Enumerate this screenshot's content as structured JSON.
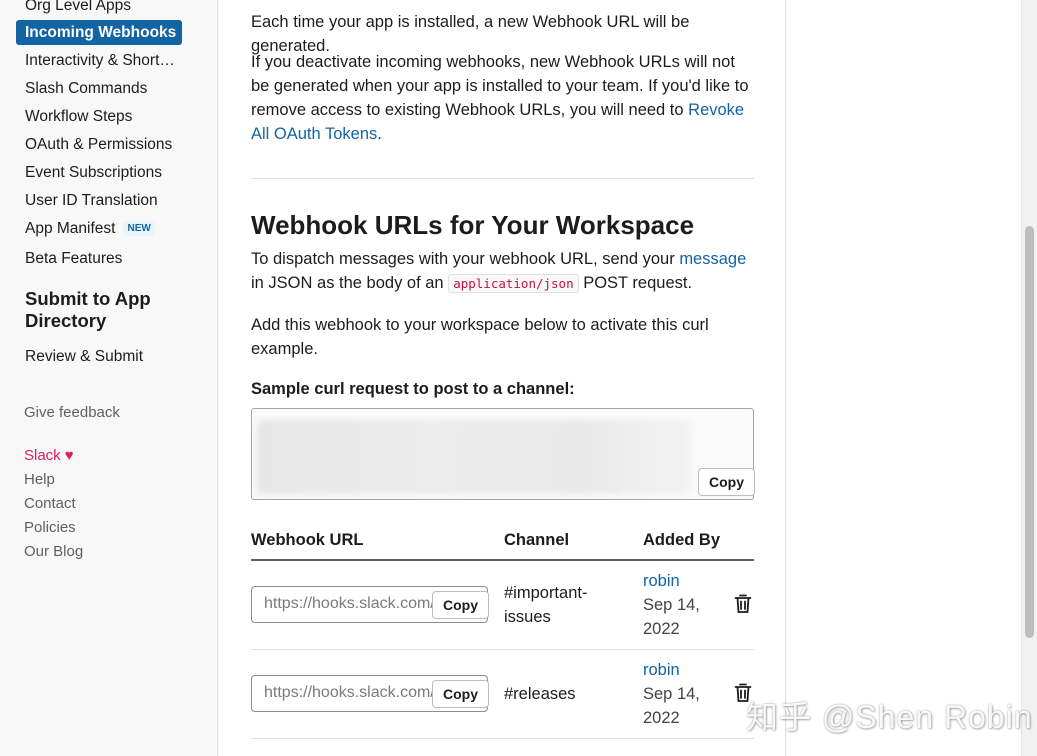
{
  "sidebar": {
    "items": [
      {
        "label": "Org Level Apps",
        "active": false
      },
      {
        "label": "Incoming Webhooks",
        "active": true
      },
      {
        "label": "Interactivity & Shortcuts",
        "active": false
      },
      {
        "label": "Slash Commands",
        "active": false
      },
      {
        "label": "Workflow Steps",
        "active": false
      },
      {
        "label": "OAuth & Permissions",
        "active": false
      },
      {
        "label": "Event Subscriptions",
        "active": false
      },
      {
        "label": "User ID Translation",
        "active": false
      },
      {
        "label": "App Manifest",
        "badge": "NEW",
        "active": false
      },
      {
        "label": "Beta Features",
        "active": false
      }
    ],
    "section_title": "Submit to App Directory",
    "review_submit": "Review & Submit",
    "give_feedback": "Give feedback",
    "footer_links": [
      "Slack",
      "Help",
      "Contact",
      "Policies",
      "Our Blog"
    ],
    "heart_icon": "heart-icon",
    "accent_color": "#1264a3",
    "slack_color": "#e01e5a"
  },
  "main": {
    "intro_1": "Each time your app is installed, a new Webhook URL will be generated.",
    "intro_2_text": "If you deactivate incoming webhooks, new Webhook URLs will not be generated when your app is installed to your team. If you'd like to remove access to existing Webhook URLs, you will need to ",
    "intro_2_link": "Revoke All OAuth Tokens",
    "intro_2_end": ".",
    "heading": "Webhook URLs for Your Workspace",
    "dispatch_1": "To dispatch messages with your webhook URL, send your ",
    "dispatch_link": "message",
    "dispatch_2": " in JSON as the body of an ",
    "dispatch_code": "application/json",
    "dispatch_3": " POST request.",
    "add_text": "Add this webhook to your workspace below to activate this curl example.",
    "sample_label": "Sample curl request to post to a channel:",
    "copy_label": "Copy",
    "table": {
      "headers": [
        "Webhook URL",
        "Channel",
        "Added By"
      ],
      "rows": [
        {
          "url": "https://hooks.slack.com/services/",
          "channel": "#important-issues",
          "user": "robin",
          "date": "Sep 14, 2022"
        },
        {
          "url": "https://hooks.slack.com/services/",
          "channel": "#releases",
          "user": "robin",
          "date": "Sep 14, 2022"
        }
      ]
    }
  },
  "watermark": "知乎 @Shen Robin"
}
